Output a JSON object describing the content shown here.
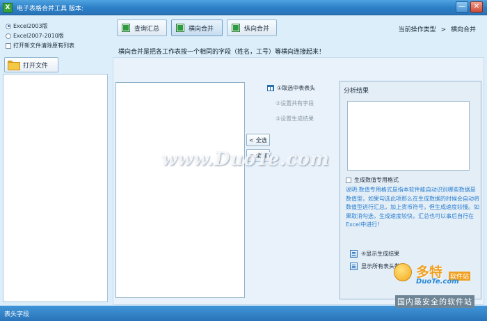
{
  "window": {
    "title": "电子表格合并工具  版本:",
    "app_icon_glyph": "X",
    "minimize_glyph": "—",
    "close_glyph": "✕"
  },
  "left": {
    "radio_excel2003": "Excel2003版",
    "radio_excel2007": "Excel2007-2010版",
    "selected_format": "Excel2003版",
    "clear_list_checkbox": "打开新文件清除原有列表",
    "clear_list_checked": false,
    "open_file_button": "打开文件"
  },
  "tabs": [
    {
      "label": "查询汇总",
      "icon": "excel-icon",
      "active": false
    },
    {
      "label": "横向合并",
      "icon": "excel-icon",
      "active": true
    },
    {
      "label": "纵向合并",
      "icon": "excel-icon",
      "active": false
    }
  ],
  "breadcrumb": {
    "label": "当前操作类型",
    "separator": ">",
    "current": "横向合并"
  },
  "description": "横向合并是把各工作表按一个相同的字段（姓名，工号）等横向连接起来！",
  "steps": {
    "step1": "①取选中表表头",
    "step2": "②设置共有字段",
    "step3": "③设置生成结果"
  },
  "transfer": {
    "select_all": "全选",
    "clear_all": "全清",
    "arrow_glyph": "<"
  },
  "analysis": {
    "title": "分析结果",
    "numeric_format_checkbox": "生成数值专用格式",
    "numeric_format_checked": false,
    "note": "说明:数值专用格式是指本软件能自动识别哪些数据是数值型，如果勾选此项那么在生成数据的时候会自动将数值型进行汇总，加上货币符号，但生成速度较慢。如果取消勾选，生成速度较快，汇总也可以事后自行在Excel中进行！",
    "show_result_button": "④显示生成结果",
    "show_all_headers_button": "显示所有表头数据"
  },
  "status": {
    "text": "表头字段"
  },
  "watermark": {
    "center": "www.DuoTe.com",
    "logo_cn": "多特",
    "logo_tag": "软件站",
    "domain": "DuoTe.com",
    "slogan": "国内最安全的软件站"
  },
  "colors": {
    "titlebar": "#2b7ec6",
    "panel_bg": "#dceefa",
    "note_text": "#2a7fd0",
    "accent_green": "#2e9b40"
  }
}
